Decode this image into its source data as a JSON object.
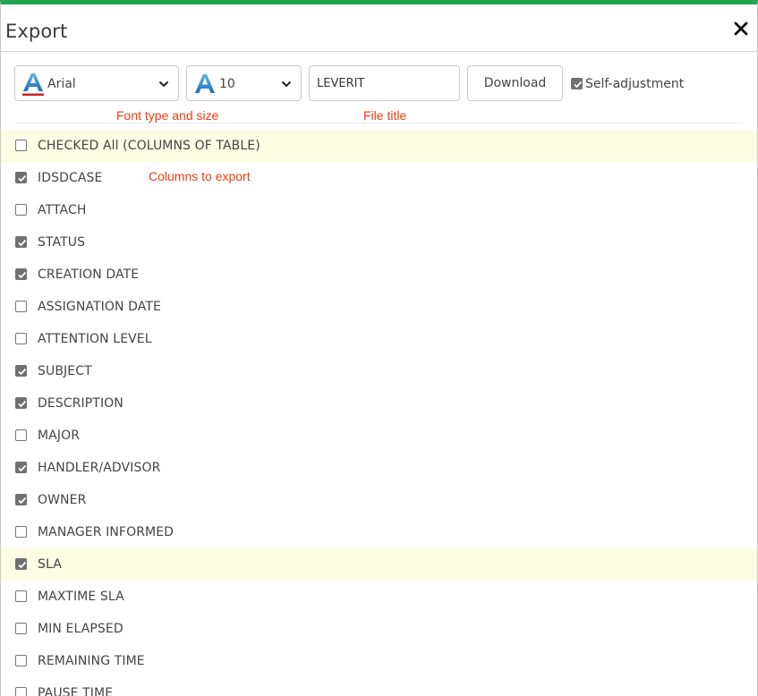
{
  "modal": {
    "title": "Export",
    "accent_color": "#1ea54d"
  },
  "toolbar": {
    "font_select": {
      "value": "Arial",
      "icon": "font-a-underline-icon"
    },
    "size_select": {
      "value": "10",
      "icon": "font-a-icon"
    },
    "file_title_input": {
      "value": "LEVERIT"
    },
    "download_label": "Download",
    "self_adjustment": {
      "label": "Self-adjustment",
      "checked": true
    }
  },
  "annotations": {
    "font_note": "Font type and size",
    "title_note": "File title",
    "columns_note": "Columns to export",
    "color": "#f03c10"
  },
  "check_all": {
    "label": "CHECKED All (COLUMNS OF TABLE)",
    "checked": false
  },
  "columns": [
    {
      "label": "IDSDCASE",
      "checked": true
    },
    {
      "label": "ATTACH",
      "checked": false
    },
    {
      "label": "STATUS",
      "checked": true
    },
    {
      "label": "CREATION DATE",
      "checked": true
    },
    {
      "label": "ASSIGNATION DATE",
      "checked": false
    },
    {
      "label": "ATTENTION LEVEL",
      "checked": false
    },
    {
      "label": "SUBJECT",
      "checked": true
    },
    {
      "label": "DESCRIPTION",
      "checked": true
    },
    {
      "label": "MAJOR",
      "checked": false
    },
    {
      "label": "HANDLER/ADVISOR",
      "checked": true
    },
    {
      "label": "OWNER",
      "checked": true
    },
    {
      "label": "MANAGER INFORMED",
      "checked": false
    },
    {
      "label": "SLA",
      "checked": true
    },
    {
      "label": "MAXTIME SLA",
      "checked": false
    },
    {
      "label": "MIN ELAPSED",
      "checked": false
    },
    {
      "label": "REMAINING TIME",
      "checked": false
    },
    {
      "label": "PAUSE TIME",
      "checked": false
    }
  ]
}
